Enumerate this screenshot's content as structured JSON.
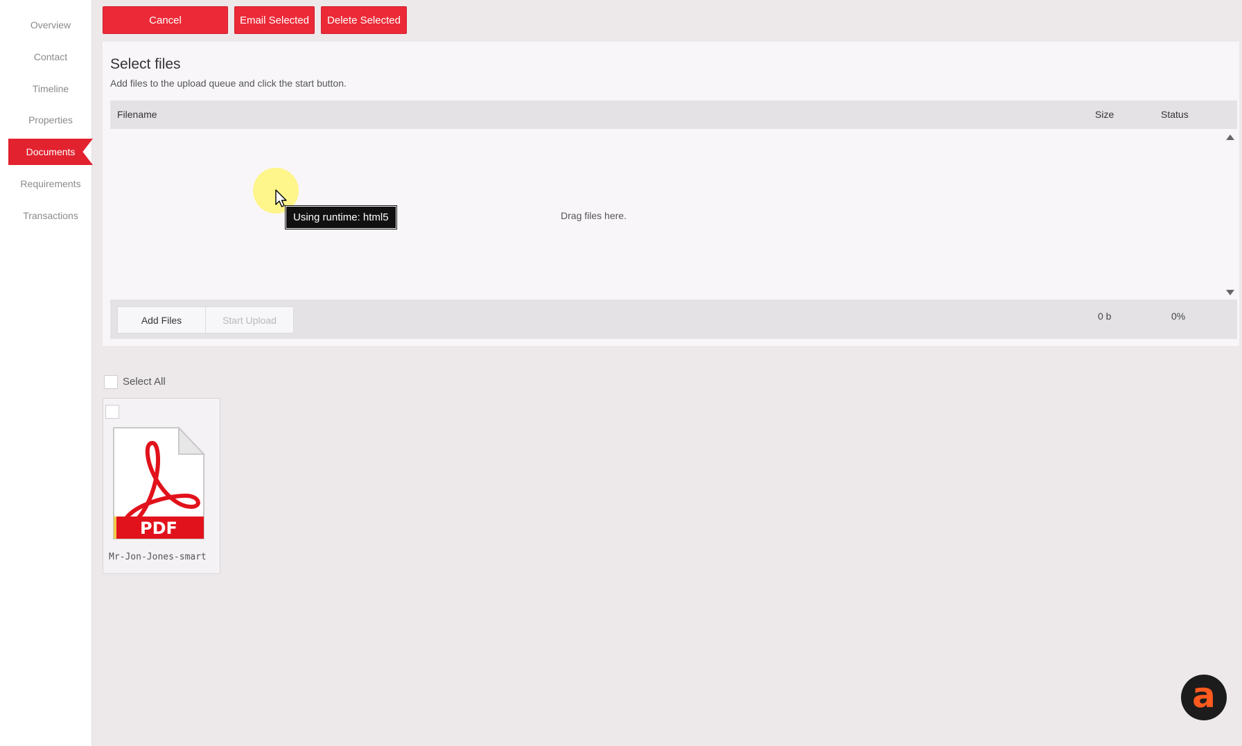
{
  "sidebar": {
    "items": [
      {
        "label": "Overview"
      },
      {
        "label": "Contact"
      },
      {
        "label": "Timeline"
      },
      {
        "label": "Properties"
      },
      {
        "label": "Documents",
        "active": true
      },
      {
        "label": "Requirements"
      },
      {
        "label": "Transactions"
      }
    ]
  },
  "toolbar": {
    "cancel_label": "Cancel",
    "email_label": "Email Selected",
    "delete_label": "Delete Selected"
  },
  "uploader": {
    "title": "Select files",
    "subtitle": "Add files to the upload queue and click the start button.",
    "columns": {
      "filename": "Filename",
      "size": "Size",
      "status": "Status"
    },
    "drop_text": "Drag files here.",
    "add_files_label": "Add Files",
    "start_upload_label": "Start Upload",
    "total_size": "0 b",
    "total_percent": "0%"
  },
  "tooltip": {
    "text": "Using runtime: html5"
  },
  "gallery": {
    "select_all_label": "Select All",
    "files": [
      {
        "name": "Mr-Jon-Jones-smart",
        "badge": "PDF",
        "icon": "pdf-file-icon"
      }
    ]
  },
  "badge": {
    "letter": "a",
    "icon": "app-logo-icon"
  },
  "colors": {
    "accent": "#ec2a37",
    "pdf_red": "#e1121b"
  }
}
